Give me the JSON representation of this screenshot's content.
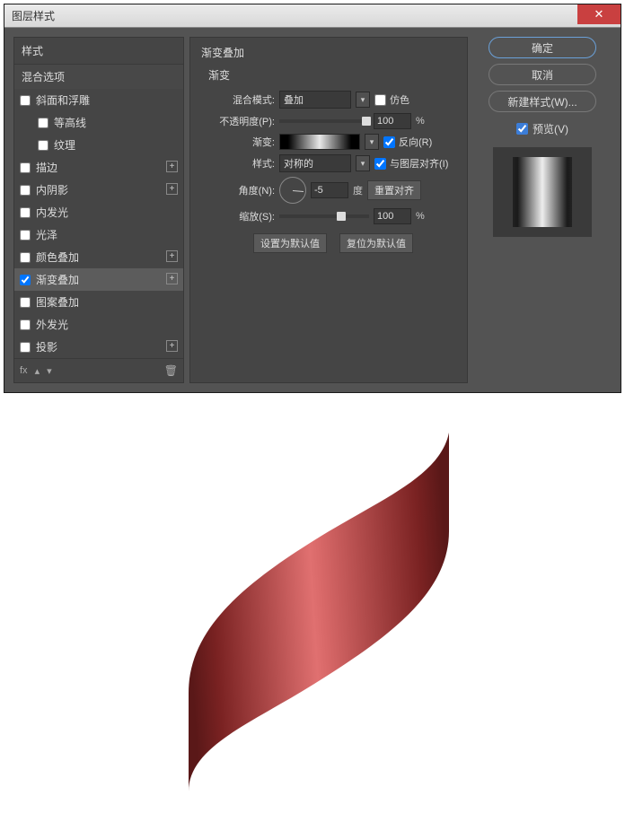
{
  "dialog": {
    "title": "图层样式"
  },
  "styles": {
    "header": "样式",
    "blending": "混合选项",
    "items": [
      {
        "label": "斜面和浮雕",
        "checked": false,
        "plus": false,
        "indent": false
      },
      {
        "label": "等高线",
        "checked": false,
        "plus": false,
        "indent": true
      },
      {
        "label": "纹理",
        "checked": false,
        "plus": false,
        "indent": true
      },
      {
        "label": "描边",
        "checked": false,
        "plus": true,
        "indent": false
      },
      {
        "label": "内阴影",
        "checked": false,
        "plus": true,
        "indent": false
      },
      {
        "label": "内发光",
        "checked": false,
        "plus": false,
        "indent": false
      },
      {
        "label": "光泽",
        "checked": false,
        "plus": false,
        "indent": false
      },
      {
        "label": "颜色叠加",
        "checked": false,
        "plus": true,
        "indent": false
      },
      {
        "label": "渐变叠加",
        "checked": true,
        "plus": true,
        "indent": false,
        "selected": true
      },
      {
        "label": "图案叠加",
        "checked": false,
        "plus": false,
        "indent": false
      },
      {
        "label": "外发光",
        "checked": false,
        "plus": false,
        "indent": false
      },
      {
        "label": "投影",
        "checked": false,
        "plus": true,
        "indent": false
      }
    ],
    "footer_fx": "fx"
  },
  "settings": {
    "section_title": "渐变叠加",
    "sub_title": "渐变",
    "blend_mode_label": "混合模式:",
    "blend_mode_value": "叠加",
    "dither_label": "仿色",
    "opacity_label": "不透明度(P):",
    "opacity_value": "100",
    "opacity_unit": "%",
    "gradient_label": "渐变:",
    "reverse_label": "反向(R)",
    "style_label": "样式:",
    "style_value": "对称的",
    "align_label": "与图层对齐(I)",
    "angle_label": "角度(N):",
    "angle_value": "-5",
    "angle_unit": "度",
    "reset_align": "重置对齐",
    "scale_label": "缩放(S):",
    "scale_value": "100",
    "scale_unit": "%",
    "set_default": "设置为默认值",
    "reset_default": "复位为默认值"
  },
  "buttons": {
    "ok": "确定",
    "cancel": "取消",
    "new_style": "新建样式(W)...",
    "preview": "预览(V)"
  }
}
